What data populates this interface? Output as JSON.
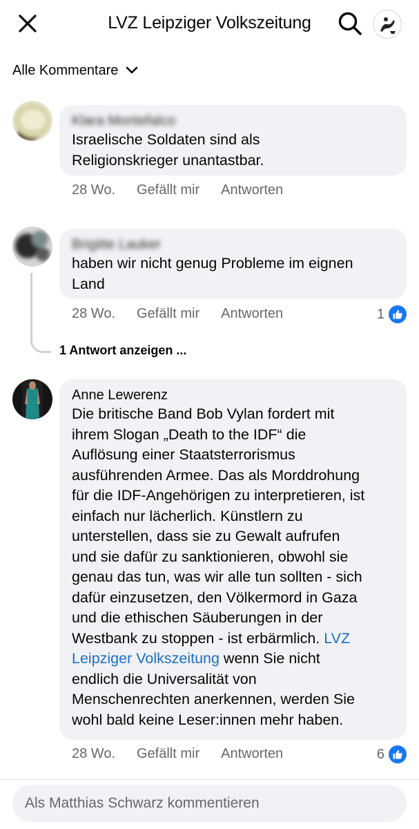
{
  "header": {
    "title": "LVZ Leipziger Volkszeitung"
  },
  "filter": {
    "label": "Alle Kommentare"
  },
  "comments": [
    {
      "author": "Klara Montefalco",
      "text_lines": [
        "Israelische Soldaten sind als",
        "Religionskrieger unantastbar."
      ],
      "time": "28 Wo.",
      "like_label": "Gefällt mir",
      "reply_label": "Antworten"
    },
    {
      "author": "Brigitte Lauker",
      "text_lines": [
        "haben wir nicht genug Probleme im eignen",
        "Land"
      ],
      "time": "28 Wo.",
      "like_label": "Gefällt mir",
      "reply_label": "Antworten",
      "likes": "1",
      "replies_link": "1 Antwort anzeigen ..."
    },
    {
      "author": "Anne Lewerenz",
      "text_lines": [
        "Die britische Band Bob Vylan fordert mit",
        "ihrem Slogan „Death to the IDF“ die",
        "Auflösung einer Staatsterrorismus",
        "ausführenden Armee. Das als Morddrohung",
        "für die IDF-Angehörigen zu interpretieren, ist",
        "einfach nur lächerlich. Künstlern zu",
        "unterstellen, dass sie zu Gewalt aufrufen",
        "und sie dafür zu sanktionieren, obwohl sie",
        "genau das tun, was wir alle tun sollten - sich",
        "dafür einzusetzen, den Völkermord in Gaza",
        "und die ethischen Säuberungen in der",
        "Westbank zu stoppen - ist erbärmlich."
      ],
      "mention_line1": "LVZ",
      "mention_line2": "Leipziger Volkszeitung",
      "after_mention": " wenn Sie nicht",
      "text_lines_end": [
        "endlich die Universalität von",
        "Menschenrechten anerkennen, werden Sie",
        "wohl bald keine Leser:innen mehr haben."
      ],
      "time": "28 Wo.",
      "like_label": "Gefällt mir",
      "reply_label": "Antworten",
      "likes": "6"
    }
  ],
  "composer": {
    "placeholder": "Als Matthias Schwarz kommentieren"
  },
  "colors": {
    "bubble": "#f0f2f5",
    "accent": "#1877f2",
    "mention": "#1b6ec4",
    "muted": "#65676b"
  },
  "icons": [
    "close-icon",
    "search-icon",
    "chevron-down-icon",
    "thumbs-up-icon"
  ]
}
